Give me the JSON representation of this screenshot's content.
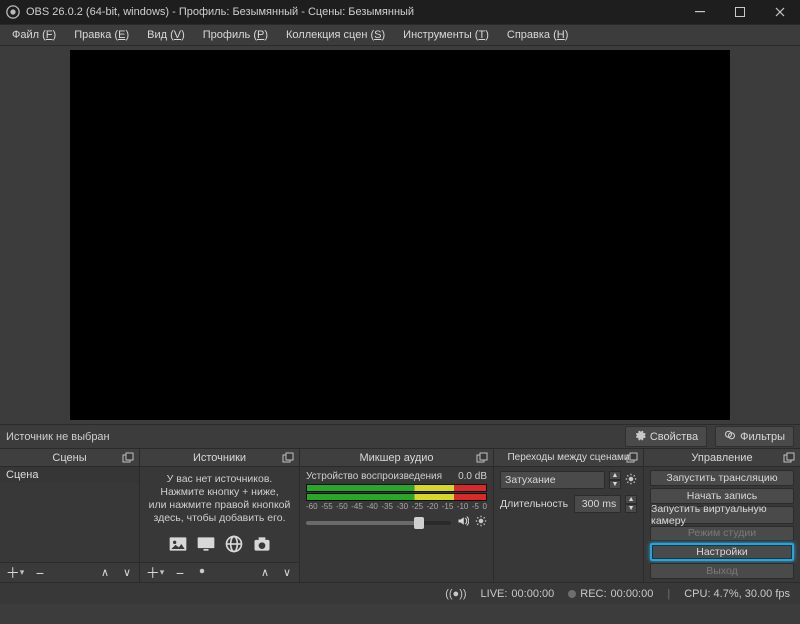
{
  "window": {
    "title": "OBS 26.0.2 (64-bit, windows) - Профиль: Безымянный - Сцены: Безымянный"
  },
  "menu": {
    "file": {
      "label": "Файл",
      "accel": "F"
    },
    "edit": {
      "label": "Правка",
      "accel": "E"
    },
    "view": {
      "label": "Вид",
      "accel": "V"
    },
    "profile": {
      "label": "Профиль",
      "accel": "P"
    },
    "scenes": {
      "label": "Коллекция сцен",
      "accel": "S"
    },
    "tools": {
      "label": "Инструменты",
      "accel": "T"
    },
    "help": {
      "label": "Справка",
      "accel": "H"
    }
  },
  "toolbar": {
    "no_source_selected": "Источник не выбран",
    "properties": "Свойства",
    "filters": "Фильтры"
  },
  "docks": {
    "scenes_title": "Сцены",
    "sources_title": "Источники",
    "mixer_title": "Микшер аудио",
    "transitions_title": "Переходы между сценами",
    "controls_title": "Управление"
  },
  "scenes": {
    "items": [
      {
        "name": "Сцена"
      }
    ]
  },
  "sources_empty": {
    "line1": "У вас нет источников.",
    "line2": "Нажмите кнопку + ниже,",
    "line3": "или нажмите правой кнопкой",
    "line4": "здесь, чтобы добавить его."
  },
  "mixer": {
    "track_name": "Устройство воспроизведения",
    "level_db": "0.0 dB",
    "scale": [
      "-60",
      "-55",
      "-50",
      "-45",
      "-40",
      "-35",
      "-30",
      "-25",
      "-20",
      "-15",
      "-10",
      "-5",
      "0"
    ]
  },
  "transitions": {
    "selected": "Затухание",
    "duration_label": "Длительность",
    "duration_value": "300 ms"
  },
  "controls": {
    "start_stream": "Запустить трансляцию",
    "start_record": "Начать запись",
    "start_vcam": "Запустить виртуальную камеру",
    "studio_mode": "Режим студии",
    "settings": "Настройки",
    "exit": "Выход"
  },
  "status": {
    "live_label": "LIVE:",
    "live_time": "00:00:00",
    "rec_label": "REC:",
    "rec_time": "00:00:00",
    "cpu": "CPU: 4.7%, 30.00 fps"
  }
}
